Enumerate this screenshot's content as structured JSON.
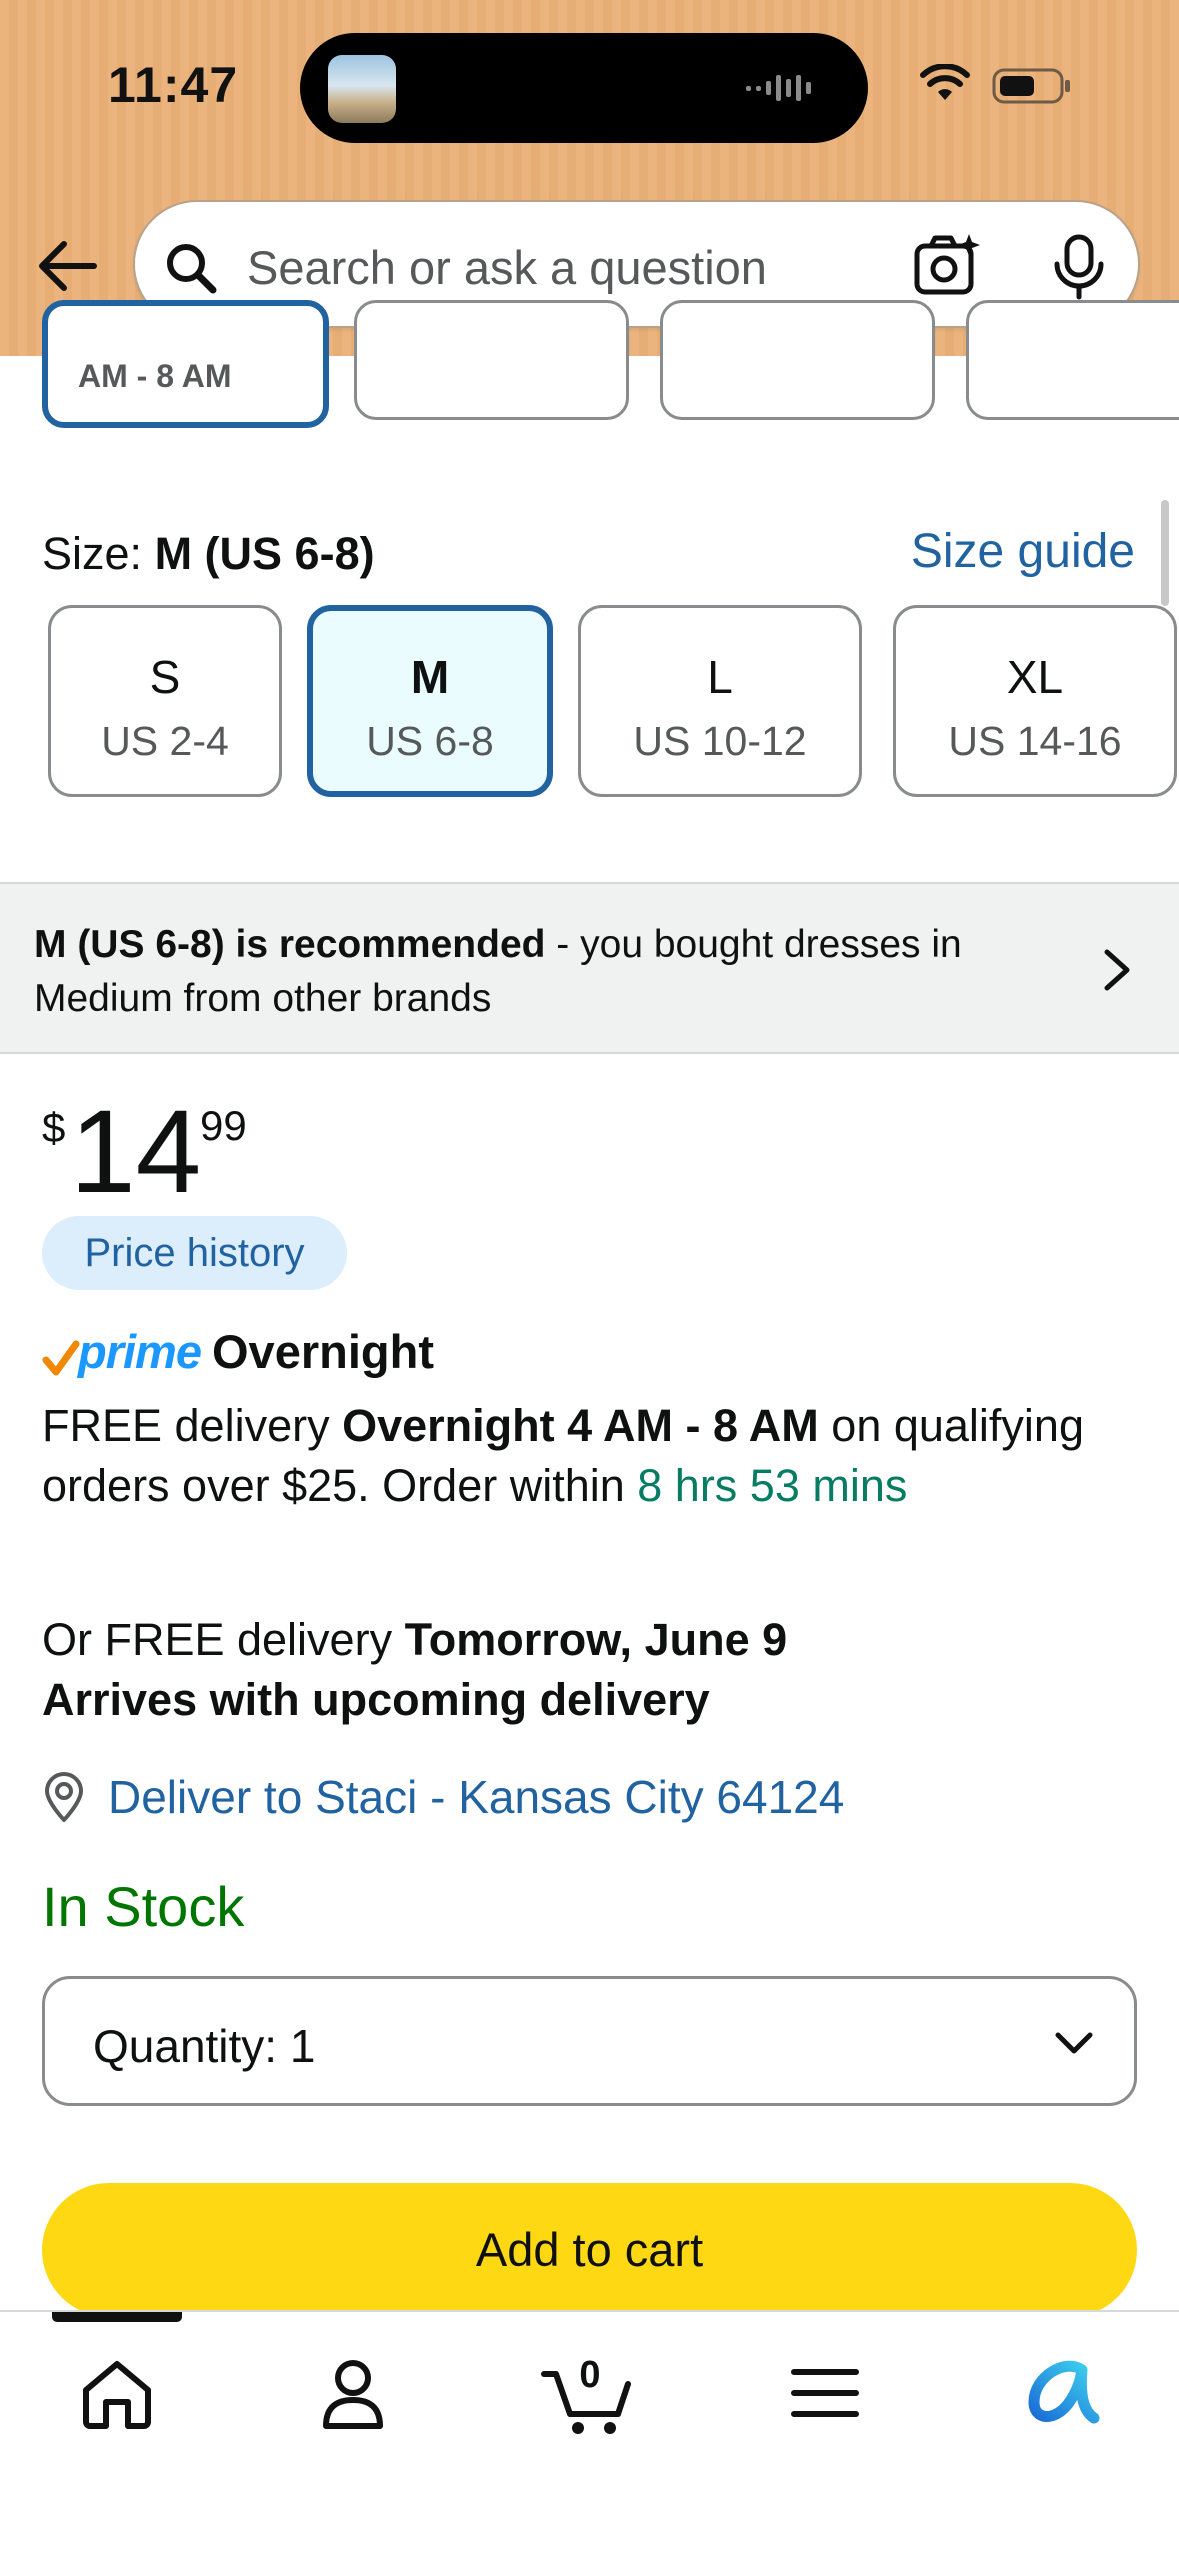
{
  "status_bar": {
    "time": "11:47"
  },
  "search": {
    "placeholder": "Search or ask a question"
  },
  "style_options": {
    "partial_selected_label": "AM - 8 AM"
  },
  "size": {
    "label_prefix": "Size:",
    "selected": "M (US 6-8)",
    "guide_link": "Size guide",
    "options": [
      {
        "main": "S",
        "sub": "US 2-4"
      },
      {
        "main": "M",
        "sub": "US 6-8"
      },
      {
        "main": "L",
        "sub": "US 10-12"
      },
      {
        "main": "XL",
        "sub": "US 14-16"
      }
    ]
  },
  "recommendation": {
    "bold": "M (US 6-8) is recommended",
    "rest": " - you bought dresses in Medium from other brands"
  },
  "price": {
    "symbol": "$",
    "whole": "14",
    "fraction": "99",
    "history_label": "Price history"
  },
  "delivery": {
    "prime_logo": "prime",
    "prime_title": "Overnight",
    "line1_a": "FREE delivery ",
    "line1_bold": "Overnight 4 AM - 8 AM",
    "line1_b": " on qualifying orders over $25. Order within ",
    "line1_timer": "8 hrs 53 mins",
    "alt_a": "Or FREE delivery ",
    "alt_bold": "Tomorrow, June 9",
    "alt_line2": "Arrives with upcoming delivery",
    "location": "Deliver to Staci - Kansas City 64124",
    "stock": "In Stock"
  },
  "quantity": {
    "label": "Quantity:",
    "value": "1"
  },
  "add_to_cart": "Add to cart",
  "bottom_nav": {
    "cart_count": "0"
  },
  "colors": {
    "header": "#EBB37D",
    "link": "#2162A1",
    "cart_button": "#FFD814",
    "in_stock": "#007600",
    "prime": "#1A98FF"
  }
}
